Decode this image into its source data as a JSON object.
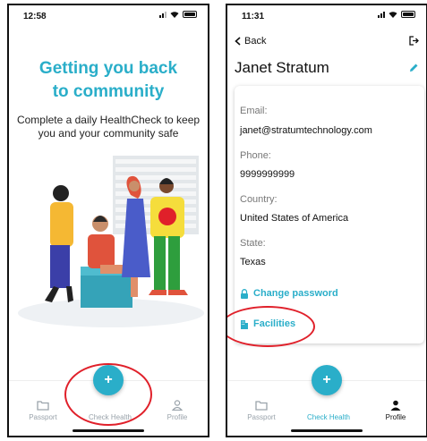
{
  "colors": {
    "accent": "#2aaec9",
    "annotation": "#e0202a"
  },
  "screens": {
    "onboarding": {
      "status_time": "12:58",
      "title_line1": "Getting you back",
      "title_line2": "to community",
      "subtitle": "Complete a daily HealthCheck to keep you and your community safe",
      "tabs": {
        "passport": "Passport",
        "check_health": "Check Health",
        "profile": "Profile"
      },
      "fab_symbol": "+"
    },
    "profile": {
      "status_time": "11:31",
      "back_label": "Back",
      "name": "Janet Stratum",
      "fields": {
        "email_label": "Email:",
        "email_value": "janet@stratumtechnology.com",
        "phone_label": "Phone:",
        "phone_value": "9999999999",
        "country_label": "Country:",
        "country_value": "United States of America",
        "state_label": "State:",
        "state_value": "Texas"
      },
      "change_password_label": "Change password",
      "facilities_label": "Facilities",
      "tabs": {
        "passport": "Passport",
        "check_health": "Check Health",
        "profile": "Profile"
      },
      "fab_symbol": "+"
    }
  },
  "icons": [
    "signal-icon",
    "wifi-icon",
    "battery-icon",
    "folder-icon",
    "person-icon",
    "chevron-left-icon",
    "logout-icon",
    "pencil-icon",
    "lock-icon",
    "building-icon"
  ]
}
